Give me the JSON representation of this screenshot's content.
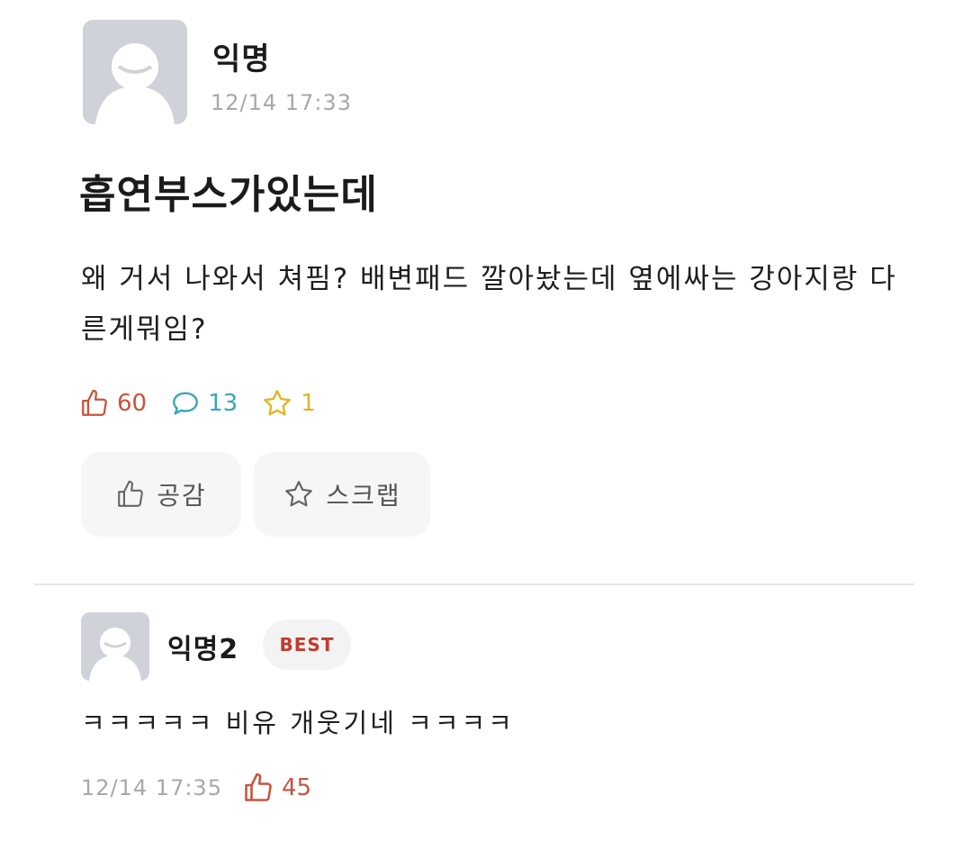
{
  "post": {
    "author": "익명",
    "timestamp": "12/14 17:33",
    "title": "흡연부스가있는데",
    "body": "왜 거서 나와서 쳐핌? 배변패드 깔아놨는데 옆에싸는 강아지랑 다른게뭐임?",
    "stats": {
      "likes": "60",
      "comments": "13",
      "scraps": "1"
    },
    "buttons": {
      "like_label": "공감",
      "scrap_label": "스크랩"
    }
  },
  "comment": {
    "author": "익명2",
    "badge": "BEST",
    "text": "ㅋㅋㅋㅋㅋ 비유 개웃기네 ㅋㅋㅋㅋ",
    "timestamp": "12/14 17:35",
    "likes": "45"
  },
  "colors": {
    "like": "#c8533d",
    "comment": "#3aa6b9",
    "scrap": "#e0b627",
    "badge": "#c23a2b",
    "avatar_bg": "#cfd3d9"
  }
}
